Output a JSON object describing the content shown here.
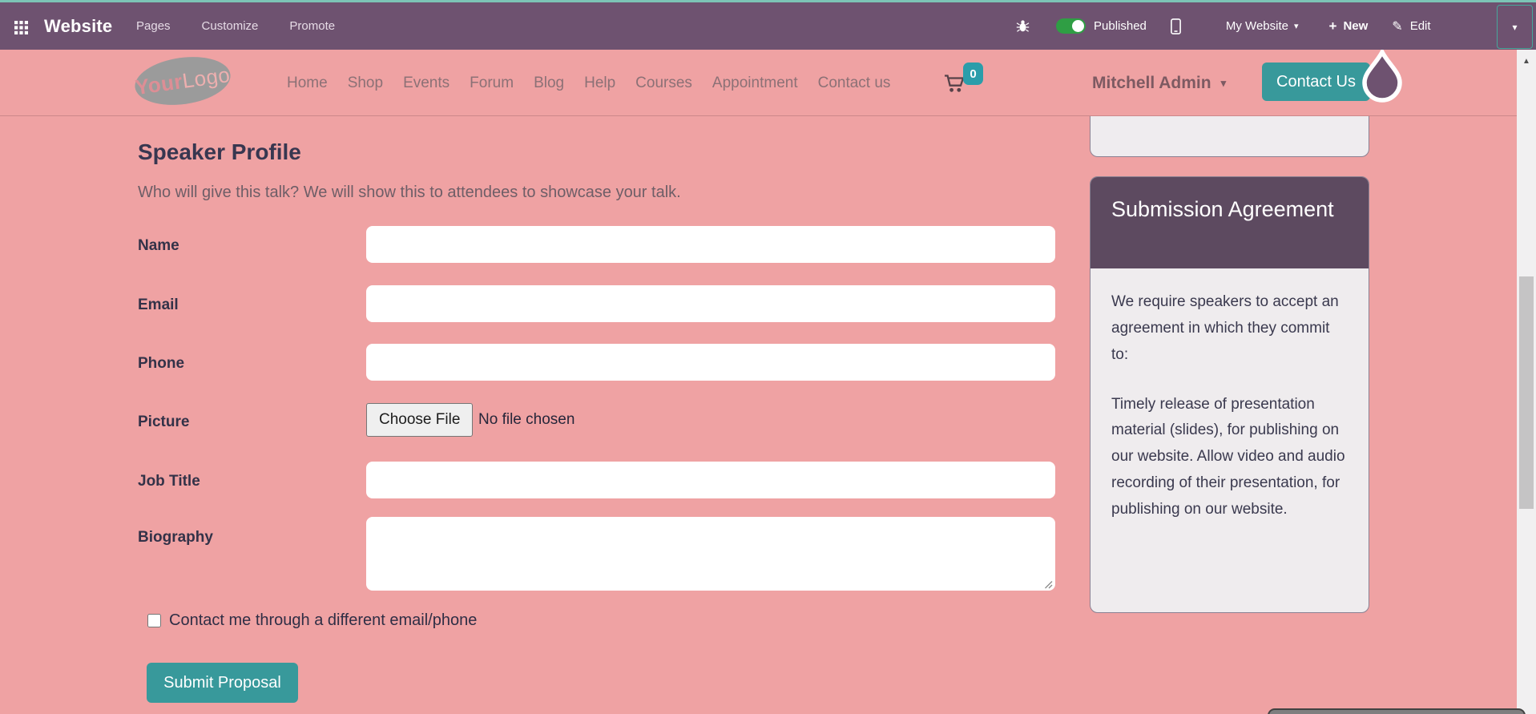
{
  "admin_bar": {
    "app_name": "Website",
    "menus": [
      "Pages",
      "Customize",
      "Promote"
    ],
    "publish_toggle_label": "Published",
    "toggle_state": "on",
    "website_selector_label": "My Website",
    "new_button_label": "New",
    "edit_button_label": "Edit"
  },
  "site_nav": {
    "logo": {
      "part1": "Your",
      "part2": "Logo"
    },
    "links": [
      "Home",
      "Shop",
      "Events",
      "Forum",
      "Blog",
      "Help",
      "Courses",
      "Appointment",
      "Contact us"
    ],
    "cart_badge_count": "0",
    "user_name": "Mitchell Admin",
    "contact_button_label": "Contact Us"
  },
  "speaker_form": {
    "title": "Speaker Profile",
    "subtitle": "Who will give this talk? We will show this to attendees to showcase your talk.",
    "fields": [
      {
        "label": "Name",
        "value": ""
      },
      {
        "label": "Email",
        "value": ""
      },
      {
        "label": "Phone",
        "value": ""
      },
      {
        "label": "Picture",
        "file_button_label": "Choose File",
        "file_status": "No file chosen"
      },
      {
        "label": "Job Title",
        "value": ""
      },
      {
        "label": "Biography",
        "value": ""
      }
    ],
    "checkbox_label": "Contact me through a different email/phone",
    "checkbox_checked": false,
    "submit_label": "Submit Proposal"
  },
  "sidebar": {
    "agreement_card": {
      "title": "Submission Agreement",
      "intro": "We require speakers to accept an agreement in which they commit to:",
      "terms": "Timely release of presentation material (slides), for publishing on our website. Allow video and audio recording of their presentation, for publishing on our website."
    }
  },
  "icons": {
    "plus": "+",
    "pencil": "✎",
    "caret_down": "▾",
    "scroll_up_arrow": "▲"
  },
  "colors": {
    "accent_teal": "#38999b",
    "admin_bar_bg": "#6e5270",
    "admin_bar_top_line": "#7cc4b6",
    "page_pink": "#efa2a3",
    "published_green": "#2f9e44",
    "card_header_bg": "#5d4a60",
    "cart_badge_teal": "#2b9daa"
  }
}
